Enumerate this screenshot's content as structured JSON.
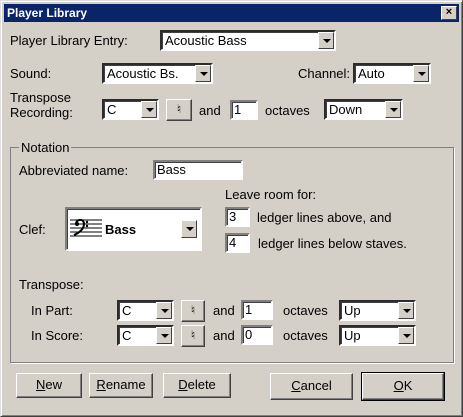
{
  "window": {
    "title": "Player Library",
    "close_glyph": "×"
  },
  "entry": {
    "label": "Player Library Entry:",
    "value": "Acoustic Bass"
  },
  "sound": {
    "label": "Sound:",
    "value": "Acoustic Bs."
  },
  "channel": {
    "label": "Channel:",
    "value": "Auto"
  },
  "transpose_recording": {
    "label_line1": "Transpose",
    "label_line2": "Recording:",
    "key": "C",
    "accidental": "♮",
    "and_label": "and",
    "octaves": "1",
    "octaves_label": "octaves",
    "direction": "Down"
  },
  "notation": {
    "legend": "Notation",
    "abbrev_label": "Abbreviated name:",
    "abbrev_value": "Bass",
    "leave_room_label": "Leave room for:",
    "ledger_above": "3",
    "ledger_above_label": "ledger lines above, and",
    "ledger_below": "4",
    "ledger_below_label": "ledger lines below staves.",
    "clef_label": "Clef:",
    "clef_value": "Bass",
    "clef_icon": "bass-clef-icon",
    "transpose_label": "Transpose:",
    "in_part": {
      "label": "In Part:",
      "key": "C",
      "accidental": "♮",
      "and_label": "and",
      "octaves": "1",
      "octaves_label": "octaves",
      "direction": "Up"
    },
    "in_score": {
      "label": "In Score:",
      "key": "C",
      "accidental": "♮",
      "and_label": "and",
      "octaves": "0",
      "octaves_label": "octaves",
      "direction": "Up"
    }
  },
  "buttons": {
    "new": {
      "label_accel": "N",
      "label_rest": "ew"
    },
    "rename": {
      "label_accel": "R",
      "label_rest": "ename"
    },
    "delete": {
      "label_accel": "D",
      "label_rest": "elete"
    },
    "cancel": {
      "label_accel": "C",
      "label_rest": "ancel"
    },
    "ok": {
      "label_accel": "O",
      "label_rest": "K"
    }
  }
}
